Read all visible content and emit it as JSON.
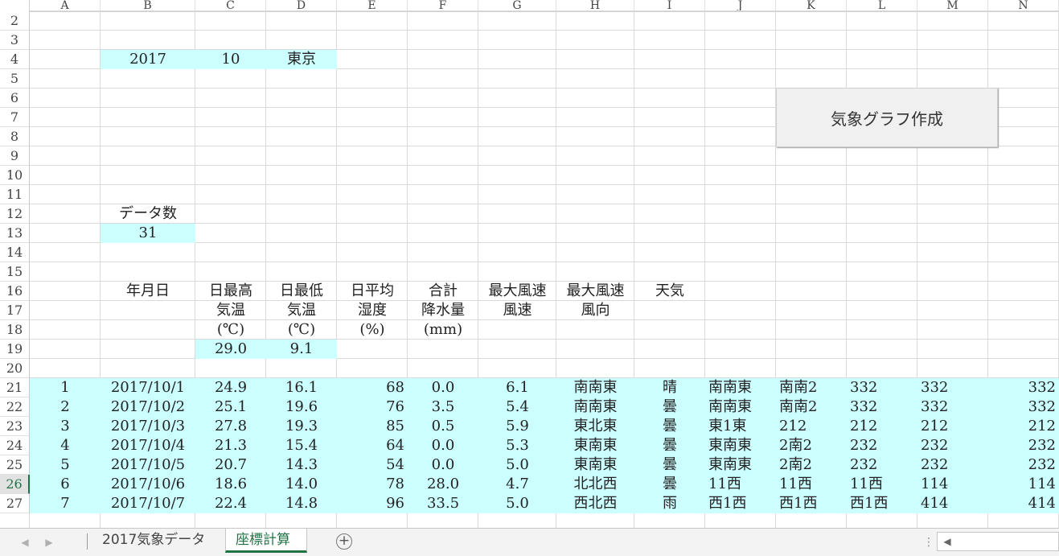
{
  "columns": [
    "A",
    "B",
    "C",
    "D",
    "E",
    "F",
    "G",
    "H",
    "I",
    "J",
    "K",
    "L",
    "M",
    "N"
  ],
  "rows": [
    "2",
    "3",
    "4",
    "5",
    "6",
    "7",
    "8",
    "9",
    "10",
    "11",
    "12",
    "13",
    "14",
    "15",
    "16",
    "17",
    "18",
    "19",
    "20",
    "21",
    "22",
    "23",
    "24",
    "25",
    "26",
    "27"
  ],
  "params": {
    "year": "2017",
    "month": "10",
    "city": "東京"
  },
  "count": {
    "label": "データ数",
    "value": "31"
  },
  "headers": {
    "date": "年月日",
    "max_temp": [
      "日最高",
      "気温",
      "(℃)"
    ],
    "min_temp": [
      "日最低",
      "気温",
      "(℃)"
    ],
    "humidity": [
      "日平均",
      "湿度",
      "(%)"
    ],
    "precip": [
      "合計",
      "降水量",
      "(mm)"
    ],
    "wind_speed": [
      "最大風速",
      "風速"
    ],
    "wind_dir": [
      "最大風速",
      "風向"
    ],
    "weather": [
      "天気"
    ]
  },
  "row19": {
    "max_temp": "29.0",
    "min_temp": "9.1"
  },
  "data": [
    [
      "1",
      "2017/10/1",
      "24.9",
      "16.1",
      "68",
      "0.0",
      "6.1",
      "南南東",
      "晴",
      "南南東",
      "南南2",
      "332",
      "332",
      "332"
    ],
    [
      "2",
      "2017/10/2",
      "25.1",
      "19.6",
      "76",
      "3.5",
      "5.4",
      "南南東",
      "曇",
      "南南東",
      "南南2",
      "332",
      "332",
      "332"
    ],
    [
      "3",
      "2017/10/3",
      "27.8",
      "19.3",
      "85",
      "0.5",
      "5.9",
      "東北東",
      "曇",
      "東1東",
      "212",
      "212",
      "212",
      "212"
    ],
    [
      "4",
      "2017/10/4",
      "21.3",
      "15.4",
      "64",
      "0.0",
      "5.3",
      "東南東",
      "曇",
      "東南東",
      "2南2",
      "232",
      "232",
      "232"
    ],
    [
      "5",
      "2017/10/5",
      "20.7",
      "14.3",
      "54",
      "0.0",
      "5.0",
      "東南東",
      "曇",
      "東南東",
      "2南2",
      "232",
      "232",
      "232"
    ],
    [
      "6",
      "2017/10/6",
      "18.6",
      "14.0",
      "78",
      "28.0",
      "4.7",
      "北北西",
      "曇",
      "11西",
      "11西",
      "11西",
      "114",
      "114"
    ],
    [
      "7",
      "2017/10/7",
      "22.4",
      "14.8",
      "96",
      "33.5",
      "5.0",
      "西北西",
      "雨",
      "西1西",
      "西1西",
      "西1西",
      "414",
      "414"
    ]
  ],
  "button": {
    "label": "気象グラフ作成"
  },
  "tabs": [
    {
      "label": "2017気象データ",
      "active": false
    },
    {
      "label": "座標計算",
      "active": true
    }
  ],
  "icons": {
    "add_sheet": "plus-circle-icon",
    "prev": "chevron-left-icon",
    "next": "chevron-right-icon"
  },
  "colors": {
    "fill": "#ccffff",
    "accent": "#217346"
  }
}
